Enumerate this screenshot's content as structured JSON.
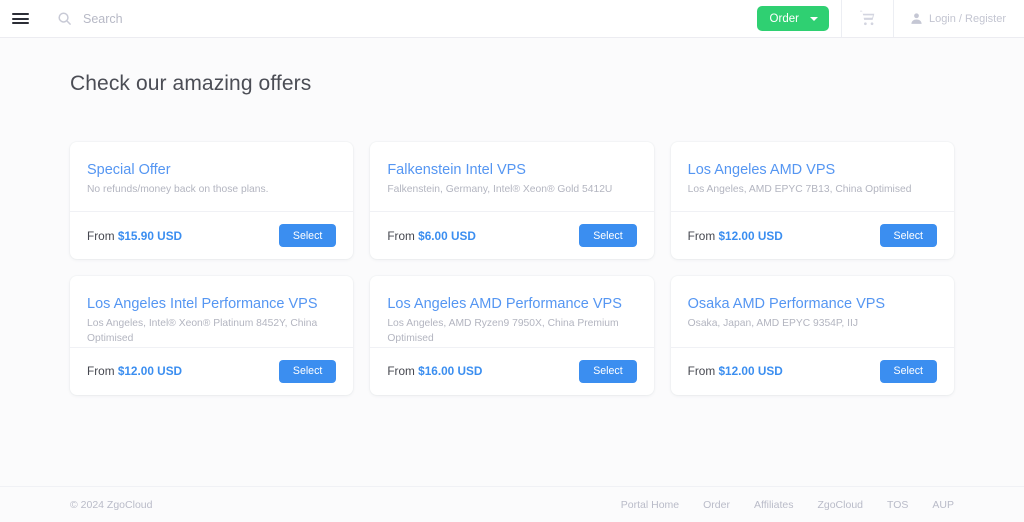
{
  "header": {
    "menu_icon": "hamburger-menu-icon",
    "search": {
      "icon": "search-icon",
      "placeholder": "Search",
      "value": ""
    },
    "order_button": {
      "label": "Order",
      "icon": "chevron-down-icon",
      "color": "#2fd072"
    },
    "cart_icon": "shopping-cart-icon",
    "account": {
      "icon": "user-icon",
      "label": "Login / Register"
    }
  },
  "main": {
    "page_title": "Check our amazing offers",
    "products": [
      {
        "name": "Special Offer",
        "description": "No refunds/money back on those plans.",
        "price_prefix": "From",
        "price": "$15.90 USD",
        "action_label": "Select"
      },
      {
        "name": "Falkenstein Intel VPS",
        "description": "Falkenstein, Germany, Intel® Xeon® Gold 5412U",
        "price_prefix": "From",
        "price": "$6.00 USD",
        "action_label": "Select"
      },
      {
        "name": "Los Angeles AMD VPS",
        "description": "Los Angeles, AMD EPYC 7B13, China Optimised",
        "price_prefix": "From",
        "price": "$12.00 USD",
        "action_label": "Select"
      },
      {
        "name": "Los Angeles Intel Performance VPS",
        "description": "Los Angeles, Intel® Xeon® Platinum 8452Y, China Optimised",
        "price_prefix": "From",
        "price": "$12.00 USD",
        "action_label": "Select"
      },
      {
        "name": "Los Angeles AMD Performance VPS",
        "description": "Los Angeles, AMD Ryzen9 7950X, China Premium Optimised",
        "price_prefix": "From",
        "price": "$16.00 USD",
        "action_label": "Select"
      },
      {
        "name": "Osaka AMD Performance VPS",
        "description": "Osaka, Japan, AMD EPYC 9354P, IIJ",
        "price_prefix": "From",
        "price": "$12.00 USD",
        "action_label": "Select"
      }
    ]
  },
  "footer": {
    "copyright": "© 2024 ZgoCloud",
    "links": [
      {
        "label": "Portal Home"
      },
      {
        "label": "Order"
      },
      {
        "label": "Affiliates"
      },
      {
        "label": "ZgoCloud"
      },
      {
        "label": "TOS"
      },
      {
        "label": "AUP"
      }
    ]
  },
  "theme": {
    "accent_blue": "#3b8ef0",
    "accent_green": "#2fd072",
    "page_background": "#fbfbfc",
    "card_background": "#ffffff",
    "muted_text": "#b9bbc8"
  }
}
